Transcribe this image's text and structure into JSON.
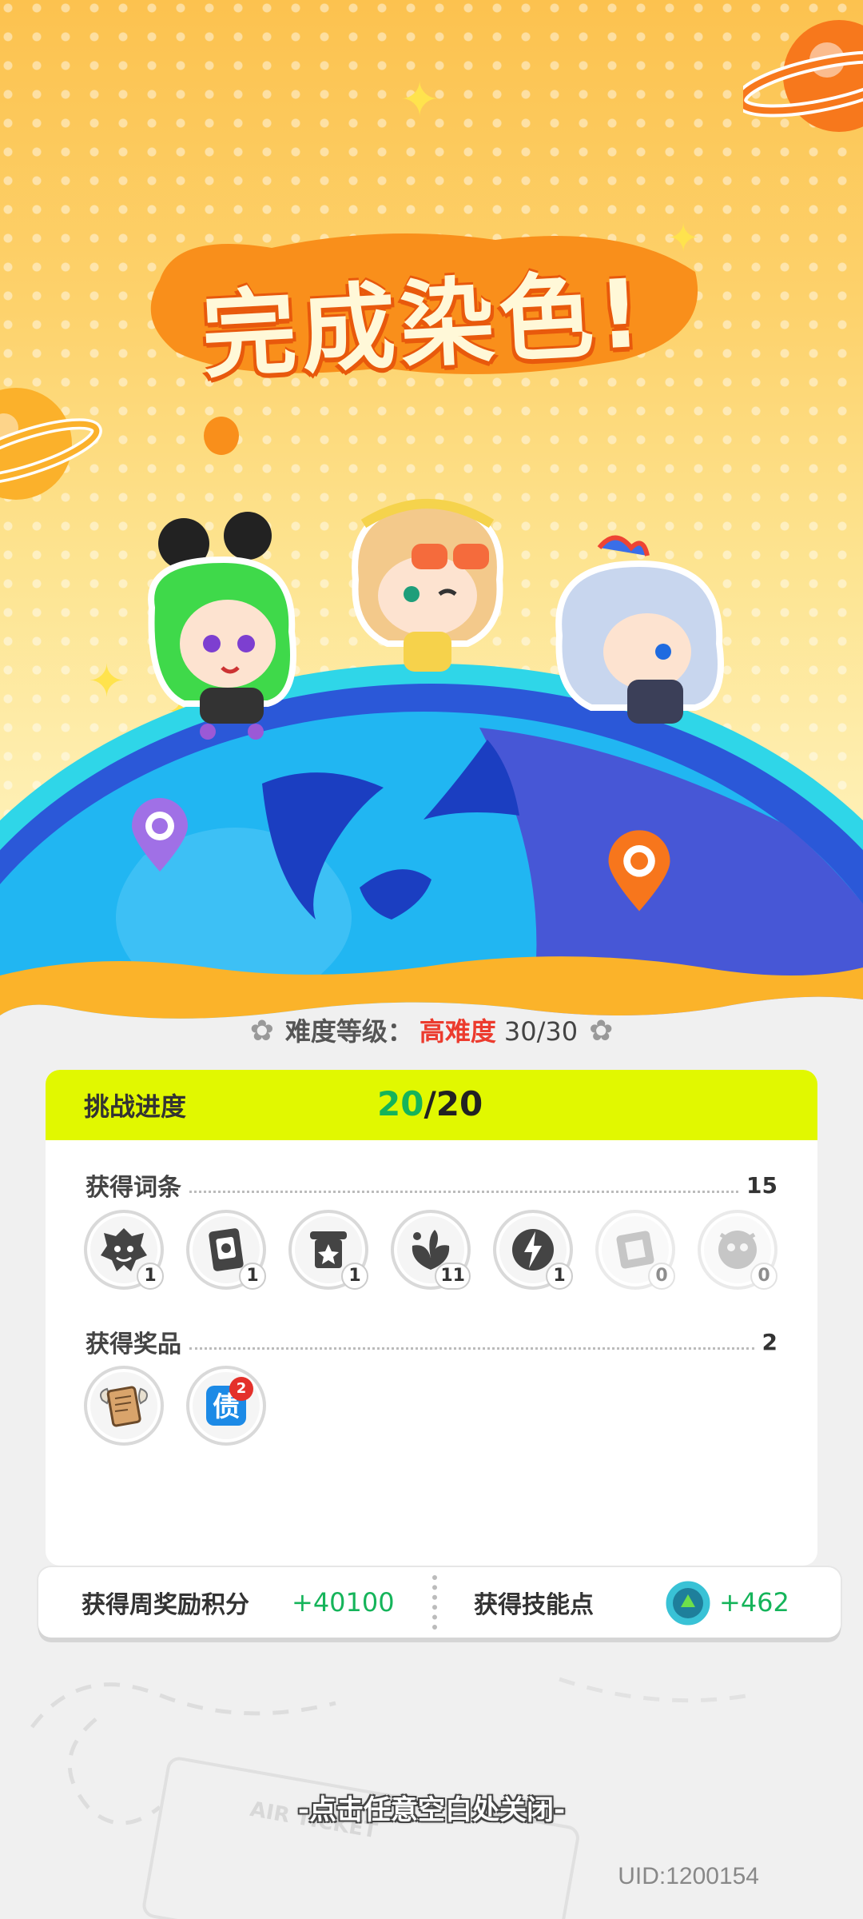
{
  "title": "完成染色!",
  "difficulty": {
    "label": "难度等级：",
    "level": "高难度",
    "count": "30/30"
  },
  "challenge": {
    "label": "挑战进度",
    "current": "20",
    "separator": "/",
    "total": "20"
  },
  "entries": {
    "label": "获得词条",
    "count": "15",
    "items": [
      {
        "icon": "lion-face-icon",
        "count": "1"
      },
      {
        "icon": "scroll-card-icon",
        "count": "1"
      },
      {
        "icon": "star-banner-icon",
        "count": "1"
      },
      {
        "icon": "leaf-sprout-icon",
        "count": "11"
      },
      {
        "icon": "lightning-icon",
        "count": "1"
      },
      {
        "icon": "film-reel-icon",
        "count": "0"
      },
      {
        "icon": "mask-face-icon",
        "count": "0"
      }
    ]
  },
  "prizes": {
    "label": "获得奖品",
    "count": "2",
    "items": [
      {
        "icon": "winged-scroll-icon"
      },
      {
        "icon": "blue-tile-icon",
        "glyph": "债",
        "badge": "2"
      }
    ]
  },
  "rewards": {
    "weekly_label": "获得周奖励积分",
    "weekly_value": "+40100",
    "skill_label": "获得技能点",
    "skill_value": "+462"
  },
  "close_hint": "-点击任意空白处关闭-",
  "uid": "UID:1200154",
  "ticket_text": "AIR TICKET",
  "colors": {
    "accent_green": "#15b45a",
    "lime": "#e1f800",
    "red": "#ec3b2e",
    "orange": "#f7761c"
  }
}
